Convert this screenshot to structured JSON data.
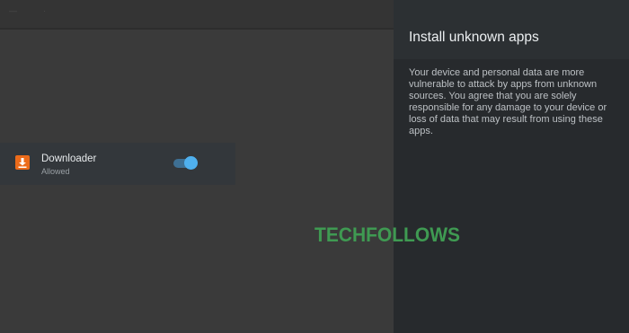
{
  "panel": {
    "title": "Install unknown apps",
    "description": "Your device and personal data are more vulnerable to attack by apps from unknown sources. You agree that you are solely responsible for any damage to your device or loss of data that may result from using these apps.",
    "apps": [
      {
        "name": "Downloader",
        "status": "Allowed",
        "icon": "download-icon",
        "icon_color": "#ec6b1a",
        "toggle_on": true
      }
    ]
  },
  "watermark": {
    "text": "TECHFOLLOWS",
    "color": "#3f9a52"
  },
  "colors": {
    "accent": "#4fb0ee",
    "panel_bg": "#272a2d",
    "row_highlight": "#33373b"
  }
}
